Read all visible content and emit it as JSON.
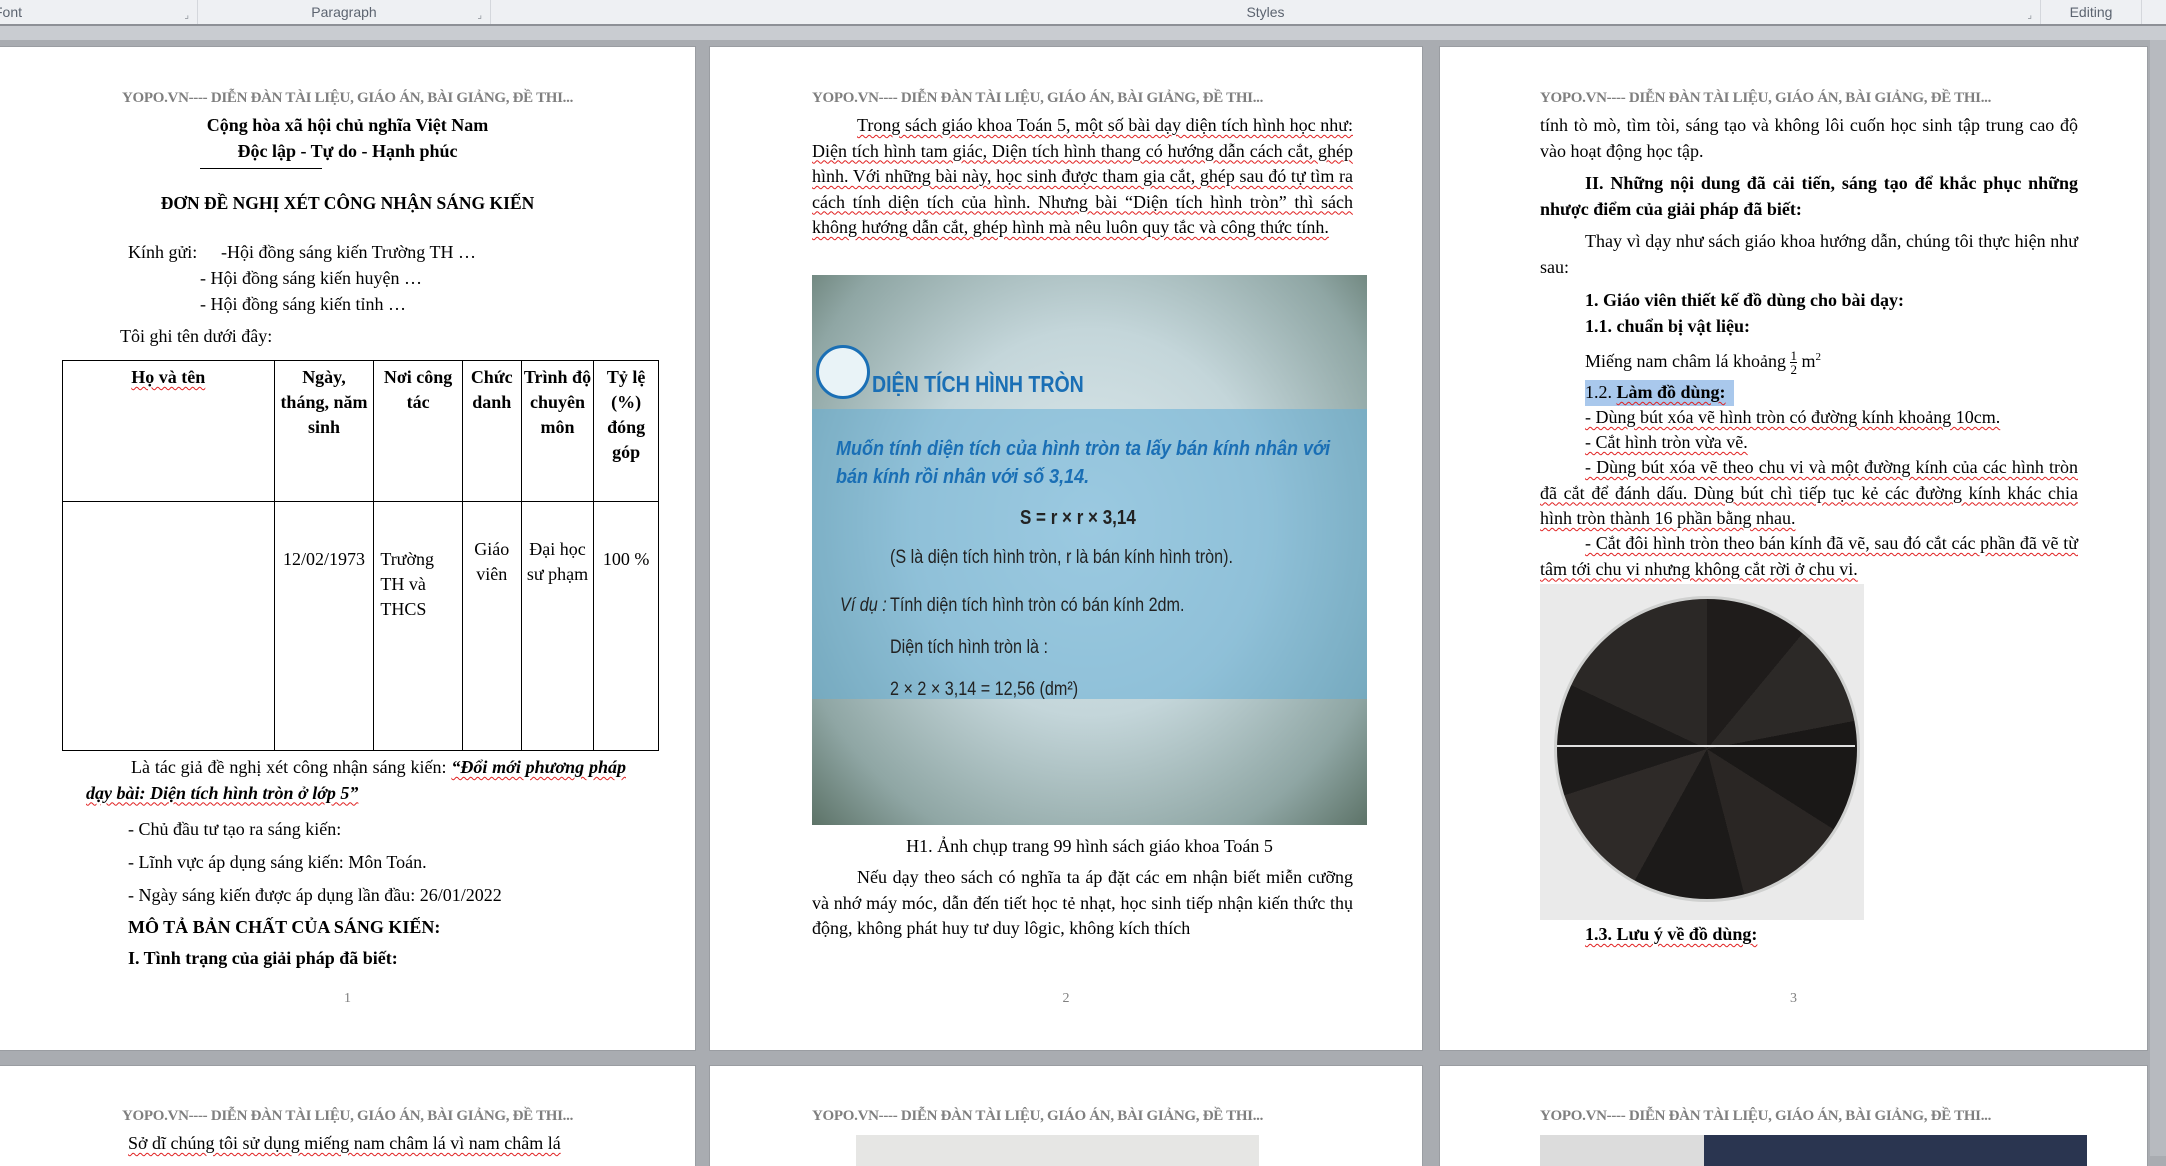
{
  "ribbon": {
    "groups": [
      "Font",
      "Paragraph",
      "Styles",
      "Editing"
    ]
  },
  "header_text": "YOPO.VN---- DIỄN ĐÀN TÀI LIỆU, GIÁO ÁN, BÀI GIẢNG, ĐỀ THI...",
  "page1": {
    "national_title": "Cộng hòa xã hội chủ nghĩa Việt Nam",
    "motto": "Độc lập - Tự do - Hạnh phúc",
    "form_title": "ĐƠN ĐỀ NGHỊ XÉT CÔNG NHẬN SÁNG KIẾN",
    "recipients_label": "Kính gửi:",
    "recipients": [
      "-Hội đồng sáng kiến Trường TH …",
      "- Hội đồng sáng kiến huyện …",
      "- Hội đồng sáng kiến tỉnh …"
    ],
    "intro": "Tôi ghi tên dưới đây:",
    "table": {
      "headers": [
        "Họ và tên",
        "Ngày, tháng, năm sinh",
        "Nơi công tác",
        "Chức danh",
        "Trình độ chuyên môn",
        "Tỷ lệ (%) đóng góp"
      ],
      "rows": [
        [
          "",
          "12/02/1973",
          "Trường TH và THCS",
          "Giáo viên",
          "Đại học sư phạm",
          "100 %"
        ]
      ]
    },
    "author_line": "Là tác giả đề nghị xét công nhận sáng kiến: ",
    "initiative_title": "“Đổi mới phương pháp dạy bài: Diện tích hình tròn ở lớp 5”",
    "investor": "- Chủ đầu tư tạo ra sáng kiến:",
    "field": "- Lĩnh vực áp dụng sáng kiến: Môn Toán.",
    "date_applied": "- Ngày sáng kiến được áp dụng lần đầu: 26/01/2022",
    "section_title": "MÔ TẢ BẢN CHẤT CỦA SÁNG KIẾN:",
    "section_i": "I. Tình trạng của giải pháp đã biết:",
    "page_number": "1"
  },
  "page2": {
    "para1": "Trong sách giáo khoa Toán 5, một số bài dạy diện tích hình học như: Diện tích hình tam giác, Diện tích hình thang có hướng dẫn cách cắt, ghép hình. Với những bài này, học sinh được tham gia cắt, ghép sau đó tự tìm ra cách tính diện tích của hình. Nhưng bài “Diện tích hình tròn” thì sách không hướng dẫn cắt, ghép hình mà nêu luôn quy tắc và công thức tính.",
    "textbook": {
      "title": "DIỆN TÍCH HÌNH TRÒN",
      "rule": "Muốn tính diện tích của hình tròn ta lấy bán kính nhân với bán kính rồi nhân với số 3,14.",
      "formula": "S = r × r × 3,14",
      "legend": "(S là diện tích hình tròn, r là bán kính hình tròn).",
      "example_label": "Ví dụ :",
      "example": "Tính diện tích hình tròn có bán kính 2dm.",
      "answer_label": "Diện tích hình tròn là :",
      "answer": "2 × 2 × 3,14 = 12,56 (dm²)"
    },
    "caption": "H1. Ảnh chụp trang 99 hình  sách giáo khoa Toán 5",
    "para2": "Nếu dạy theo sách có nghĩa ta áp đặt các em nhận biết miễn cưỡng và nhớ máy móc, dẫn đến tiết học tẻ nhạt, học sinh tiếp nhận kiến thức thụ động, không phát huy tư duy lôgic, không kích thích",
    "page_number": "2"
  },
  "page3": {
    "para1": "tính tò mò, tìm tòi, sáng tạo và không lôi cuốn học sinh tập trung cao độ vào hoạt động học tập.",
    "section_ii": "II. Những nội dung đã cải tiến, sáng tạo để khắc phục những nhược điểm của giải pháp đã biết:",
    "para2": "Thay vì dạy như sách giáo khoa hướng dẫn, chúng tôi thực hiện như sau:",
    "h1": "1.  Giáo viên thiết kế đồ dùng cho bài dạy:",
    "h11": "1.1. chuẩn bị vật liệu:",
    "material": "Miếng nam châm lá khoảng ",
    "frac_num": "1",
    "frac_den": "2",
    "unit": "m",
    "unit_sup": "2",
    "h12_num": "1.2. ",
    "h12": "Làm đồ dùng:",
    "steps": [
      "- Dùng bút xóa vẽ hình tròn có đường kính khoảng 10cm.",
      "- Cắt hình tròn vừa vẽ.",
      "- Dùng bút xóa vẽ theo chu vi và một đường kính của các hình tròn đã cắt để đánh dấu. Dùng bút chì tiếp tục kẻ các đường kính khác chia hình tròn thành 16 phần bằng nhau.",
      "- Cắt đôi hình tròn theo bán kính đã vẽ, sau đó cắt các phần đã vẽ từ tâm tới chu vi nhưng không cắt rời ở chu vi."
    ],
    "h13": "1.3. Lưu ý về đồ dùng:",
    "page_number": "3"
  },
  "page4": {
    "para1": "Sở dĩ chúng tôi sử dụng miếng nam châm lá vì nam châm lá"
  },
  "colors": {
    "header_gray": "#7f7f7f",
    "textbook_blue": "#1a6fb5",
    "selection": "#a9c8ec"
  }
}
